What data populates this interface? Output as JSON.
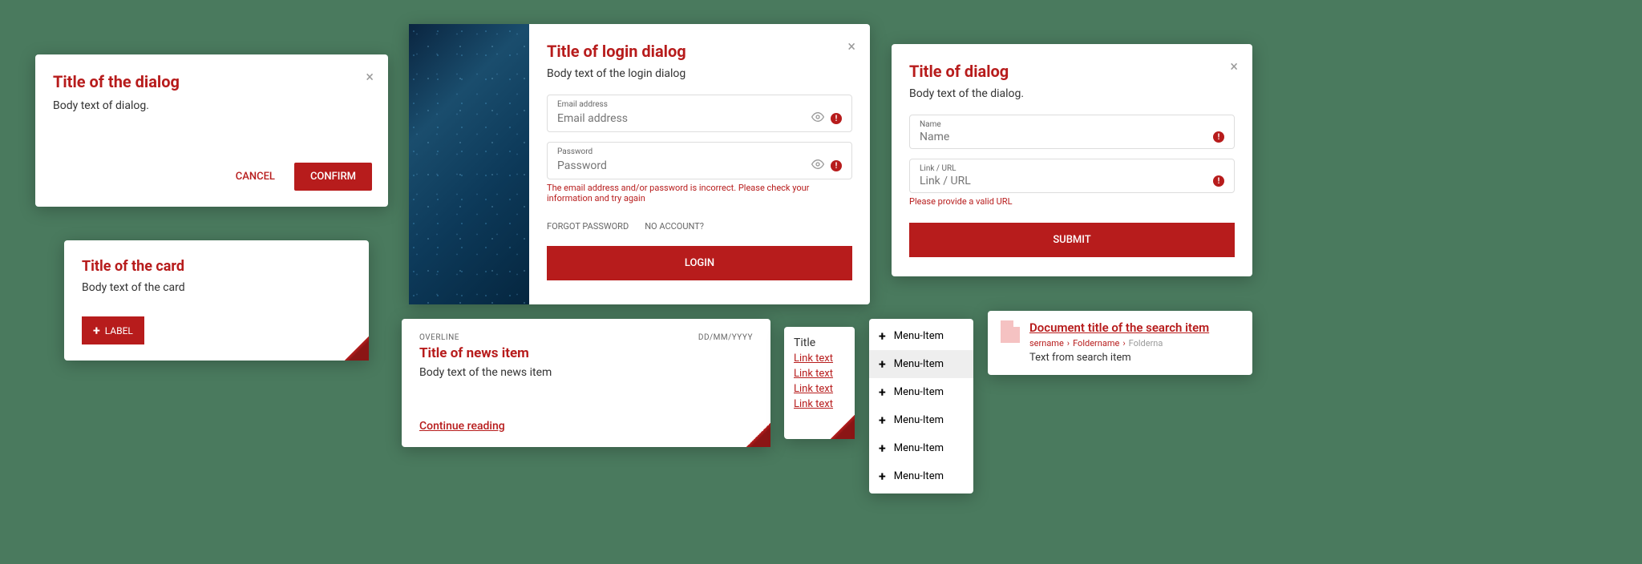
{
  "colors": {
    "accent": "#b71c1c"
  },
  "dialog1": {
    "title": "Title of the dialog",
    "body": "Body text of dialog.",
    "cancel": "CANCEL",
    "confirm": "CONFIRM"
  },
  "card1": {
    "title": "Title of the card",
    "body": "Body text of the card",
    "button_label": "LABEL"
  },
  "login": {
    "title": "Title of login dialog",
    "body": "Body text of the login dialog",
    "email_label": "Email address",
    "email_placeholder": "Email address",
    "password_label": "Password",
    "password_placeholder": "Password",
    "error": "The email address and/or password is incorrect. Please check your information and try again",
    "forgot": "FORGOT PASSWORD",
    "noaccount": "NO ACCOUNT?",
    "submit": "LOGIN"
  },
  "dialog2": {
    "title": "Title of dialog",
    "body": "Body text of the dialog.",
    "name_label": "Name",
    "name_placeholder": "Name",
    "url_label": "Link / URL",
    "url_placeholder": "Link / URL",
    "url_error": "Please provide a valid URL",
    "submit": "SUBMIT"
  },
  "news": {
    "overline": "OVERLINE",
    "date": "DD/MM/YYYY",
    "title": "Title of news item",
    "body": "Body text of the news item",
    "continue": "Continue reading"
  },
  "linkcard": {
    "title": "Title",
    "links": [
      "Link text",
      "Link text",
      "Link text",
      "Link text"
    ]
  },
  "menu": {
    "items": [
      "Menu-Item",
      "Menu-Item",
      "Menu-Item",
      "Menu-Item",
      "Menu-Item",
      "Menu-Item"
    ]
  },
  "search": {
    "title": "Document title of the search item",
    "breadcrumbs": [
      "sername",
      "Foldername",
      "Folderna"
    ],
    "text": "Text from search item"
  }
}
